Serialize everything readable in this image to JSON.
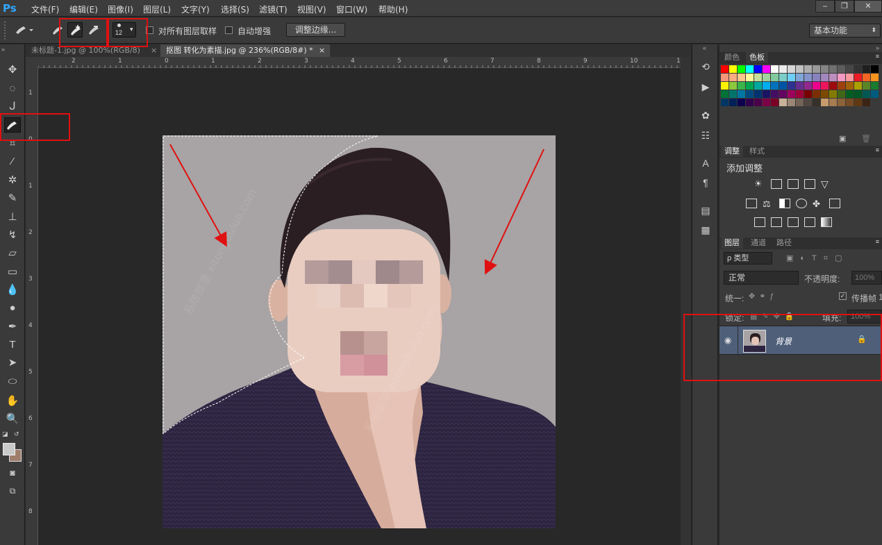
{
  "app": {
    "logo": "Ps"
  },
  "menu": [
    "文件(F)",
    "编辑(E)",
    "图像(I)",
    "图层(L)",
    "文字(Y)",
    "选择(S)",
    "滤镜(T)",
    "视图(V)",
    "窗口(W)",
    "帮助(H)"
  ],
  "window_controls": [
    "–",
    "❐",
    "✕"
  ],
  "options": {
    "brush_size": "12",
    "sample_all_layers": "对所有图层取样",
    "auto_enhance": "自动增强",
    "refine_edge": "调整边缘...",
    "workspace": "基本功能"
  },
  "tabs": [
    {
      "label": "未标题-1.jpg @ 100%(RGB/8)",
      "close": "×"
    },
    {
      "label": "抠图 转化为素描.jpg @ 236%(RGB/8#) *",
      "close": "×"
    }
  ],
  "ruler_h": [
    "2",
    "1",
    "0",
    "1",
    "2",
    "3",
    "4",
    "5",
    "6",
    "7",
    "8",
    "9",
    "10",
    "11"
  ],
  "ruler_v": [
    "1",
    "0",
    "1",
    "2",
    "3",
    "4",
    "5",
    "6",
    "7",
    "8"
  ],
  "panels": {
    "color_tabs": [
      "颜色",
      "色板"
    ],
    "adjust_tabs": [
      "调整",
      "样式"
    ],
    "add_adjustment": "添加调整",
    "layer_tabs": [
      "图层",
      "通道",
      "路径"
    ],
    "kind_filter": "ρ 类型",
    "blend_mode": "正常",
    "opacity_label": "不透明度:",
    "opacity_value": "100%",
    "unify_label": "统一:",
    "propagate_label": "传播帧",
    "propagate_value": "1",
    "lock_label": "锁定:",
    "fill_label": "填充:",
    "fill_value": "100%",
    "layer_name": "背景"
  },
  "watermark": "系统部落 xitongbuluo.com",
  "colors": {
    "accent_red": "#e01010",
    "ps_blue": "#31a8ff",
    "layer_selected": "#4f5f7a"
  }
}
